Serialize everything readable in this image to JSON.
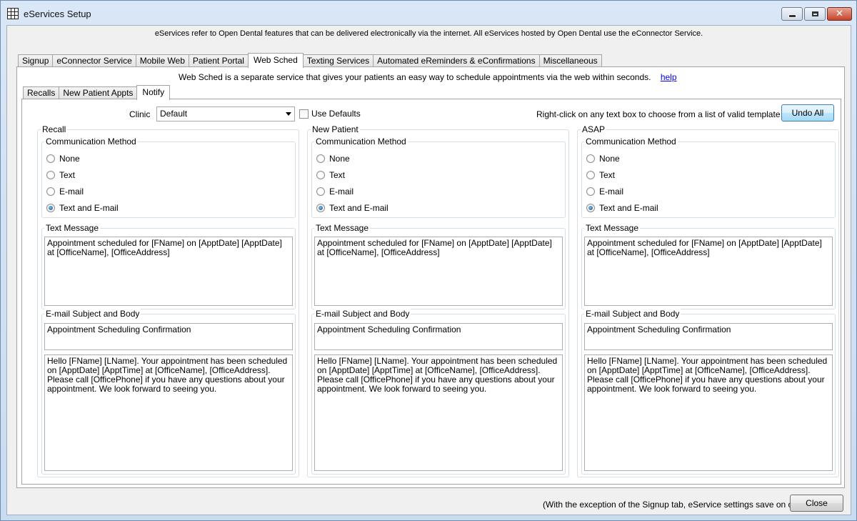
{
  "window": {
    "title": "eServices Setup"
  },
  "intro_text": "eServices refer to Open Dental features that can be delivered electronically via the internet.  All eServices hosted by Open Dental use the eConnector Service.",
  "outer_tabs": [
    {
      "label": "Signup",
      "active": false
    },
    {
      "label": "eConnector Service",
      "active": false
    },
    {
      "label": "Mobile Web",
      "active": false
    },
    {
      "label": "Patient Portal",
      "active": false
    },
    {
      "label": "Web Sched",
      "active": true
    },
    {
      "label": "Texting Services",
      "active": false
    },
    {
      "label": "Automated eReminders & eConfirmations",
      "active": false
    },
    {
      "label": "Miscellaneous",
      "active": false
    }
  ],
  "websched": {
    "intro": "Web Sched is a separate service that gives your patients an easy way to schedule appointments via the web within seconds.",
    "help_link": "help"
  },
  "inner_tabs": [
    {
      "label": "Recalls",
      "active": false
    },
    {
      "label": "New Patient Appts",
      "active": false
    },
    {
      "label": "Notify",
      "active": true
    }
  ],
  "notify": {
    "clinic_label": "Clinic",
    "clinic_value": "Default",
    "use_defaults_label": "Use Defaults",
    "use_defaults_checked": false,
    "right_click_note": "Right-click on any text box to choose from a list of valid template fields.",
    "undo_all_label": "Undo All",
    "groups": [
      {
        "title": "Recall",
        "comm_method_title": "Communication Method",
        "options": [
          "None",
          "Text",
          "E-mail",
          "Text and E-mail"
        ],
        "selected": "Text and E-mail",
        "text_message_title": "Text Message",
        "text_message": "Appointment scheduled for [FName] on [ApptDate] [ApptDate] at [OfficeName], [OfficeAddress]",
        "email_title": "E-mail Subject and Body",
        "email_subject": "Appointment Scheduling Confirmation",
        "email_body": "Hello [FName] [LName]. Your appointment has been scheduled on [ApptDate] [ApptTime] at [OfficeName], [OfficeAddress]. Please call [OfficePhone] if you have any questions about your appointment. We look forward to seeing you."
      },
      {
        "title": "New Patient",
        "comm_method_title": "Communication Method",
        "options": [
          "None",
          "Text",
          "E-mail",
          "Text and E-mail"
        ],
        "selected": "Text and E-mail",
        "text_message_title": "Text Message",
        "text_message": "Appointment scheduled for [FName] on [ApptDate] [ApptDate] at [OfficeName], [OfficeAddress]",
        "email_title": "E-mail Subject and Body",
        "email_subject": "Appointment Scheduling Confirmation",
        "email_body": "Hello [FName] [LName]. Your appointment has been scheduled on [ApptDate] [ApptTime] at [OfficeName], [OfficeAddress]. Please call [OfficePhone] if you have any questions about your appointment. We look forward to seeing you."
      },
      {
        "title": "ASAP",
        "comm_method_title": "Communication Method",
        "options": [
          "None",
          "Text",
          "E-mail",
          "Text and E-mail"
        ],
        "selected": "Text and E-mail",
        "text_message_title": "Text Message",
        "text_message": "Appointment scheduled for [FName] on [ApptDate] [ApptDate] at [OfficeName], [OfficeAddress]",
        "email_title": "E-mail Subject and Body",
        "email_subject": "Appointment Scheduling Confirmation",
        "email_body": "Hello [FName] [LName]. Your appointment has been scheduled on [ApptDate] [ApptTime] at [OfficeName], [OfficeAddress]. Please call [OfficePhone] if you have any questions about your appointment. We look forward to seeing you."
      }
    ]
  },
  "footer": {
    "note": "(With the exception of the Signup tab, eService settings save on close)",
    "close_label": "Close"
  }
}
